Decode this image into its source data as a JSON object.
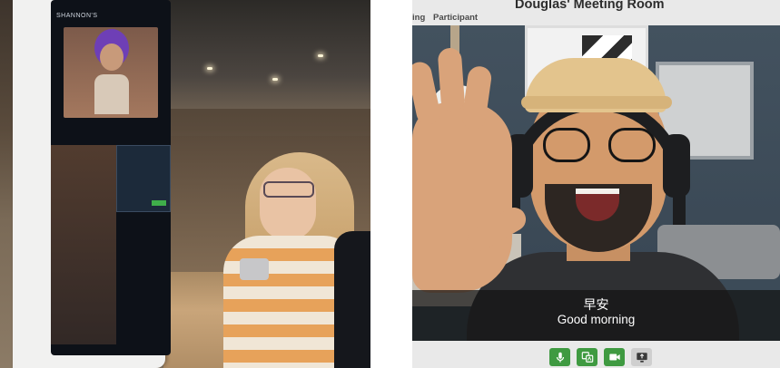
{
  "left_photo": {
    "kiosk_brand": "SHANNON'S"
  },
  "meeting": {
    "title": "Douglas' Meeting Room",
    "tabs": [
      {
        "label": "ing"
      },
      {
        "label": "Participant"
      }
    ],
    "caption": {
      "original": "早安",
      "translation": "Good morning"
    },
    "controls": [
      {
        "icon": "microphone-icon",
        "state": "on",
        "color": "#3f9a41"
      },
      {
        "icon": "translate-icon",
        "state": "on",
        "color": "#3f9a41"
      },
      {
        "icon": "video-camera-icon",
        "state": "on",
        "color": "#3f9a41"
      },
      {
        "icon": "screen-share-icon",
        "state": "off",
        "color": "#cfcfcf"
      }
    ]
  }
}
